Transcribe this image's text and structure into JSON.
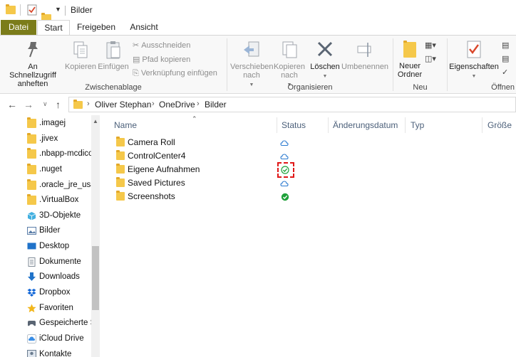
{
  "window": {
    "title": "Bilder"
  },
  "tabs": [
    {
      "label": "Datei"
    },
    {
      "label": "Start"
    },
    {
      "label": "Freigeben"
    },
    {
      "label": "Ansicht"
    }
  ],
  "ribbon": {
    "zwischenablage": {
      "label": "Zwischenablage",
      "pin": "An Schnellzugriff anheften",
      "pin_line1": "An Schnellzugriff",
      "pin_line2": "anheften",
      "copy": "Kopieren",
      "paste": "Einfügen",
      "cut": "Ausschneiden",
      "copy_path": "Pfad kopieren",
      "paste_shortcut": "Verknüpfung einfügen"
    },
    "organisieren": {
      "label": "Organisieren",
      "move_line1": "Verschieben",
      "move_line2": "nach",
      "copyto_line1": "Kopieren",
      "copyto_line2": "nach",
      "delete": "Löschen",
      "rename": "Umbenennen"
    },
    "neu": {
      "label": "Neu",
      "newfolder_line1": "Neuer",
      "newfolder_line2": "Ordner"
    },
    "oeffnen": {
      "label": "Öffnen",
      "properties": "Eigenschaften"
    }
  },
  "address": {
    "crumbs": [
      "Oliver Stephan",
      "OneDrive",
      "Bilder"
    ]
  },
  "navpane": {
    "items": [
      {
        "label": ".imagej",
        "icon": "folder-icon"
      },
      {
        "label": ".jivex",
        "icon": "folder-icon"
      },
      {
        "label": ".nbapp-mcdicom",
        "icon": "folder-icon"
      },
      {
        "label": ".nuget",
        "icon": "folder-icon"
      },
      {
        "label": ".oracle_jre_usage",
        "icon": "folder-icon"
      },
      {
        "label": ".VirtualBox",
        "icon": "folder-icon"
      },
      {
        "label": "3D-Objekte",
        "icon": "3d-objects-icon"
      },
      {
        "label": "Bilder",
        "icon": "pictures-icon"
      },
      {
        "label": "Desktop",
        "icon": "desktop-icon"
      },
      {
        "label": "Dokumente",
        "icon": "documents-icon"
      },
      {
        "label": "Downloads",
        "icon": "downloads-icon"
      },
      {
        "label": "Dropbox",
        "icon": "dropbox-icon"
      },
      {
        "label": "Favoriten",
        "icon": "star-icon"
      },
      {
        "label": "Gespeicherte Spiele",
        "icon": "saved-games-icon"
      },
      {
        "label": "iCloud Drive",
        "icon": "icloud-icon"
      },
      {
        "label": "Kontakte",
        "icon": "contacts-icon"
      }
    ]
  },
  "filelist": {
    "columns": [
      "Name",
      "Status",
      "Änderungsdatum",
      "Typ",
      "Größe"
    ],
    "rows": [
      {
        "name": "Camera Roll",
        "status": "cloud"
      },
      {
        "name": "ControlCenter4",
        "status": "cloud"
      },
      {
        "name": "Eigene Aufnahmen",
        "status": "available-locally"
      },
      {
        "name": "Saved Pictures",
        "status": "cloud"
      },
      {
        "name": "Screenshots",
        "status": "always-available"
      }
    ]
  },
  "colors": {
    "datei_tab": "#7b7c1a",
    "folder": "#f5c84a",
    "cloud": "#2b7ad0",
    "sync_green": "#1fa13a",
    "highlight": "#e01818"
  }
}
